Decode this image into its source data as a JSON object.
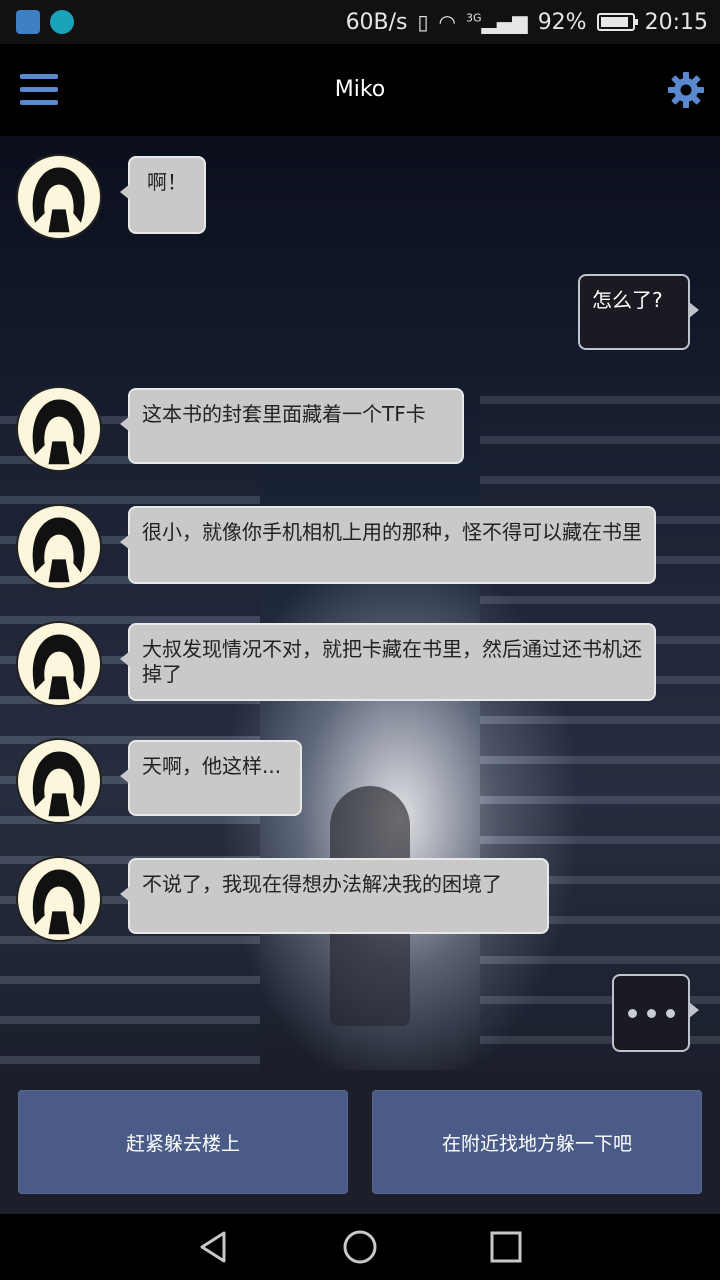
{
  "status_bar": {
    "net_speed": "60B/s",
    "network": "3G",
    "battery": "92%",
    "battery_level": 0.92,
    "time": "20:15"
  },
  "header": {
    "title": "Miko"
  },
  "messages": [
    {
      "side": "left",
      "text": "啊！"
    },
    {
      "side": "right",
      "text": "怎么了?"
    },
    {
      "side": "left",
      "text": "这本书的封套里面藏着一个TF卡"
    },
    {
      "side": "left",
      "text": "很小，就像你手机相机上用的那种，怪不得可以藏在书里"
    },
    {
      "side": "left",
      "text": "大叔发现情况不对，就把卡藏在书里，然后通过还书机还掉了"
    },
    {
      "side": "left",
      "text": "天啊，他这样..."
    },
    {
      "side": "left",
      "text": "不说了，我现在得想办法解决我的困境了"
    },
    {
      "side": "right",
      "typing": true
    }
  ],
  "choices": [
    {
      "label": "赶紧躲去楼上"
    },
    {
      "label": "在附近找地方躲一下吧"
    }
  ],
  "colors": {
    "accent": "#5b89d0",
    "choice_button": "#4a5b88",
    "left_bubble": "#c9c9c9",
    "right_bubble": "#1a1a22"
  }
}
